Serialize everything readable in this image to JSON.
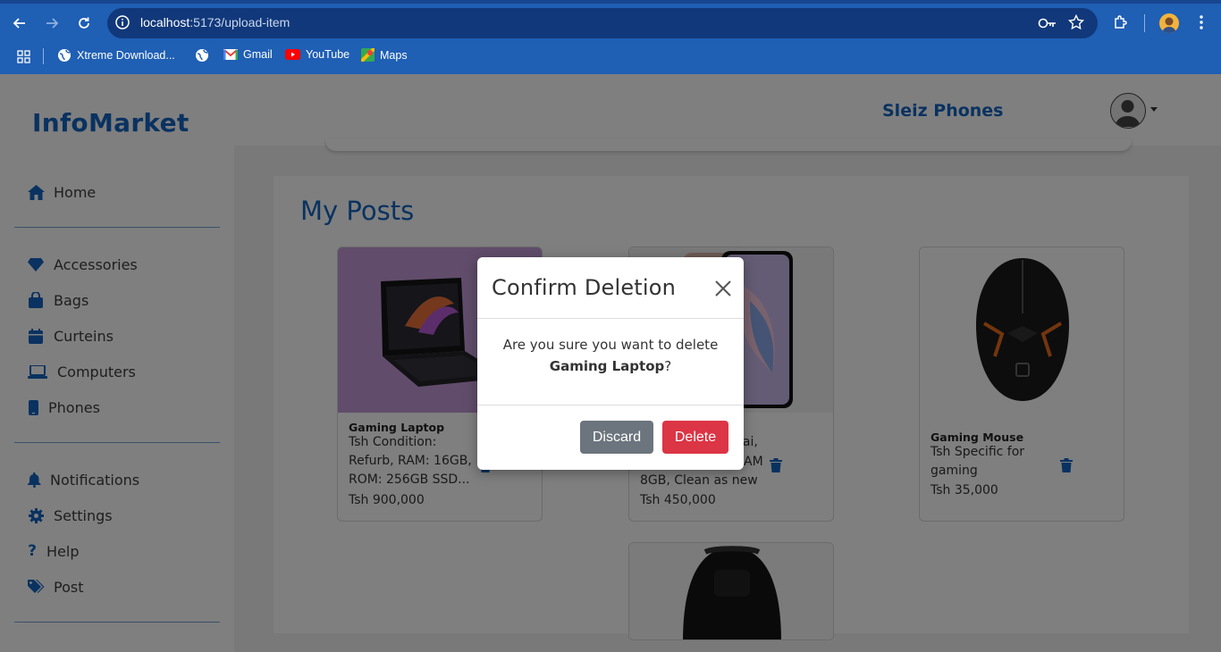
{
  "browser": {
    "url_host": "localhost",
    "url_path": ":5173/upload-item",
    "bookmarks": [
      {
        "label": "Xtreme Download..."
      },
      {
        "label": ""
      },
      {
        "label": "Gmail"
      },
      {
        "label": "YouTube"
      },
      {
        "label": "Maps"
      }
    ]
  },
  "app": {
    "brand": "InfoMarket",
    "shop_name": "Sleiz Phones",
    "sidebar": {
      "top": [
        {
          "label": "Home",
          "icon": "home-icon"
        }
      ],
      "categories": [
        {
          "label": "Accessories",
          "icon": "gem-icon"
        },
        {
          "label": "Bags",
          "icon": "bag-icon"
        },
        {
          "label": "Curteins",
          "icon": "calendar-icon"
        },
        {
          "label": "Computers",
          "icon": "laptop-icon"
        },
        {
          "label": "Phones",
          "icon": "phone-icon"
        }
      ],
      "settings": [
        {
          "label": "Notifications",
          "icon": "bell-icon"
        },
        {
          "label": "Settings",
          "icon": "gear-icon"
        },
        {
          "label": "Help",
          "icon": "question-icon"
        },
        {
          "label": "Post",
          "icon": "tags-icon"
        }
      ]
    },
    "posts_title": "My Posts",
    "posts": [
      {
        "name": "Gaming Laptop",
        "description": "Tsh Condition: Refurb, RAM: 16GB, ROM: 256GB SSD...",
        "price": "Tsh 900,000"
      },
      {
        "name": "",
        "description_line1": "bai,",
        "description_line2": "AM",
        "description_line3": "8GB, Clean as new",
        "price": "Tsh 450,000"
      },
      {
        "name": "Gaming Mouse",
        "description": "Tsh Specific for gaming",
        "price": "Tsh 35,000"
      }
    ]
  },
  "modal": {
    "title": "Confirm Deletion",
    "message_prefix": "Are you sure you want to delete",
    "item_name": "Gaming Laptop",
    "message_suffix": "?",
    "discard_label": "Discard",
    "delete_label": "Delete"
  },
  "colors": {
    "brand_blue": "#1565c0",
    "delete_red": "#dc3545",
    "discard_gray": "#6c757d",
    "chrome_blue": "#1f5fb4"
  }
}
